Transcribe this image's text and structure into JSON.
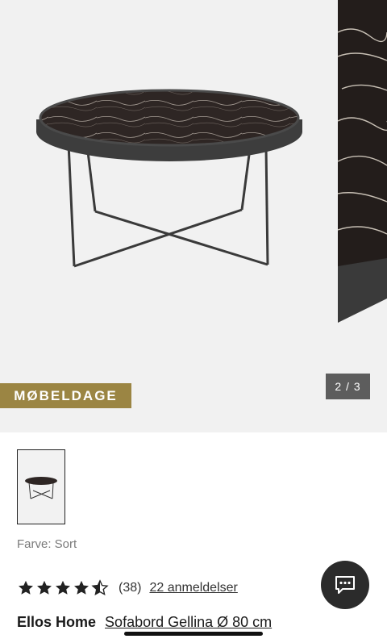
{
  "gallery": {
    "badge_label": "MØBELDAGE",
    "counter_text": "2 / 3"
  },
  "product": {
    "color_line": "Farve: Sort",
    "rating_value": 4.5,
    "rating_count": "(38)",
    "reviews_link": "22 anmeldelser",
    "brand": "Ellos Home",
    "name": "Sofabord Gellina Ø 80 cm"
  },
  "icons": {
    "chat": "chat-bubble-icon",
    "star": "star-icon"
  },
  "colors": {
    "badge_bg": "#9b8543",
    "counter_bg": "#5d5d5d",
    "chat_bg": "#2b2b2b",
    "gallery_bg": "#f1f1f1"
  }
}
